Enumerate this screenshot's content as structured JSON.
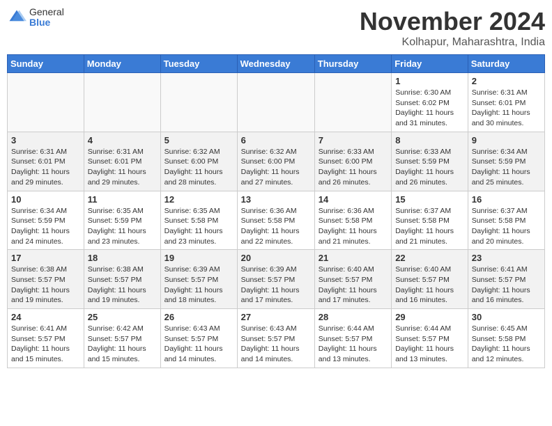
{
  "logo": {
    "general": "General",
    "blue": "Blue"
  },
  "title": "November 2024",
  "location": "Kolhapur, Maharashtra, India",
  "weekdays": [
    "Sunday",
    "Monday",
    "Tuesday",
    "Wednesday",
    "Thursday",
    "Friday",
    "Saturday"
  ],
  "weeks": [
    [
      {
        "day": "",
        "info": ""
      },
      {
        "day": "",
        "info": ""
      },
      {
        "day": "",
        "info": ""
      },
      {
        "day": "",
        "info": ""
      },
      {
        "day": "",
        "info": ""
      },
      {
        "day": "1",
        "info": "Sunrise: 6:30 AM\nSunset: 6:02 PM\nDaylight: 11 hours\nand 31 minutes."
      },
      {
        "day": "2",
        "info": "Sunrise: 6:31 AM\nSunset: 6:01 PM\nDaylight: 11 hours\nand 30 minutes."
      }
    ],
    [
      {
        "day": "3",
        "info": "Sunrise: 6:31 AM\nSunset: 6:01 PM\nDaylight: 11 hours\nand 29 minutes."
      },
      {
        "day": "4",
        "info": "Sunrise: 6:31 AM\nSunset: 6:01 PM\nDaylight: 11 hours\nand 29 minutes."
      },
      {
        "day": "5",
        "info": "Sunrise: 6:32 AM\nSunset: 6:00 PM\nDaylight: 11 hours\nand 28 minutes."
      },
      {
        "day": "6",
        "info": "Sunrise: 6:32 AM\nSunset: 6:00 PM\nDaylight: 11 hours\nand 27 minutes."
      },
      {
        "day": "7",
        "info": "Sunrise: 6:33 AM\nSunset: 6:00 PM\nDaylight: 11 hours\nand 26 minutes."
      },
      {
        "day": "8",
        "info": "Sunrise: 6:33 AM\nSunset: 5:59 PM\nDaylight: 11 hours\nand 26 minutes."
      },
      {
        "day": "9",
        "info": "Sunrise: 6:34 AM\nSunset: 5:59 PM\nDaylight: 11 hours\nand 25 minutes."
      }
    ],
    [
      {
        "day": "10",
        "info": "Sunrise: 6:34 AM\nSunset: 5:59 PM\nDaylight: 11 hours\nand 24 minutes."
      },
      {
        "day": "11",
        "info": "Sunrise: 6:35 AM\nSunset: 5:59 PM\nDaylight: 11 hours\nand 23 minutes."
      },
      {
        "day": "12",
        "info": "Sunrise: 6:35 AM\nSunset: 5:58 PM\nDaylight: 11 hours\nand 23 minutes."
      },
      {
        "day": "13",
        "info": "Sunrise: 6:36 AM\nSunset: 5:58 PM\nDaylight: 11 hours\nand 22 minutes."
      },
      {
        "day": "14",
        "info": "Sunrise: 6:36 AM\nSunset: 5:58 PM\nDaylight: 11 hours\nand 21 minutes."
      },
      {
        "day": "15",
        "info": "Sunrise: 6:37 AM\nSunset: 5:58 PM\nDaylight: 11 hours\nand 21 minutes."
      },
      {
        "day": "16",
        "info": "Sunrise: 6:37 AM\nSunset: 5:58 PM\nDaylight: 11 hours\nand 20 minutes."
      }
    ],
    [
      {
        "day": "17",
        "info": "Sunrise: 6:38 AM\nSunset: 5:57 PM\nDaylight: 11 hours\nand 19 minutes."
      },
      {
        "day": "18",
        "info": "Sunrise: 6:38 AM\nSunset: 5:57 PM\nDaylight: 11 hours\nand 19 minutes."
      },
      {
        "day": "19",
        "info": "Sunrise: 6:39 AM\nSunset: 5:57 PM\nDaylight: 11 hours\nand 18 minutes."
      },
      {
        "day": "20",
        "info": "Sunrise: 6:39 AM\nSunset: 5:57 PM\nDaylight: 11 hours\nand 17 minutes."
      },
      {
        "day": "21",
        "info": "Sunrise: 6:40 AM\nSunset: 5:57 PM\nDaylight: 11 hours\nand 17 minutes."
      },
      {
        "day": "22",
        "info": "Sunrise: 6:40 AM\nSunset: 5:57 PM\nDaylight: 11 hours\nand 16 minutes."
      },
      {
        "day": "23",
        "info": "Sunrise: 6:41 AM\nSunset: 5:57 PM\nDaylight: 11 hours\nand 16 minutes."
      }
    ],
    [
      {
        "day": "24",
        "info": "Sunrise: 6:41 AM\nSunset: 5:57 PM\nDaylight: 11 hours\nand 15 minutes."
      },
      {
        "day": "25",
        "info": "Sunrise: 6:42 AM\nSunset: 5:57 PM\nDaylight: 11 hours\nand 15 minutes."
      },
      {
        "day": "26",
        "info": "Sunrise: 6:43 AM\nSunset: 5:57 PM\nDaylight: 11 hours\nand 14 minutes."
      },
      {
        "day": "27",
        "info": "Sunrise: 6:43 AM\nSunset: 5:57 PM\nDaylight: 11 hours\nand 14 minutes."
      },
      {
        "day": "28",
        "info": "Sunrise: 6:44 AM\nSunset: 5:57 PM\nDaylight: 11 hours\nand 13 minutes."
      },
      {
        "day": "29",
        "info": "Sunrise: 6:44 AM\nSunset: 5:57 PM\nDaylight: 11 hours\nand 13 minutes."
      },
      {
        "day": "30",
        "info": "Sunrise: 6:45 AM\nSunset: 5:58 PM\nDaylight: 11 hours\nand 12 minutes."
      }
    ]
  ]
}
